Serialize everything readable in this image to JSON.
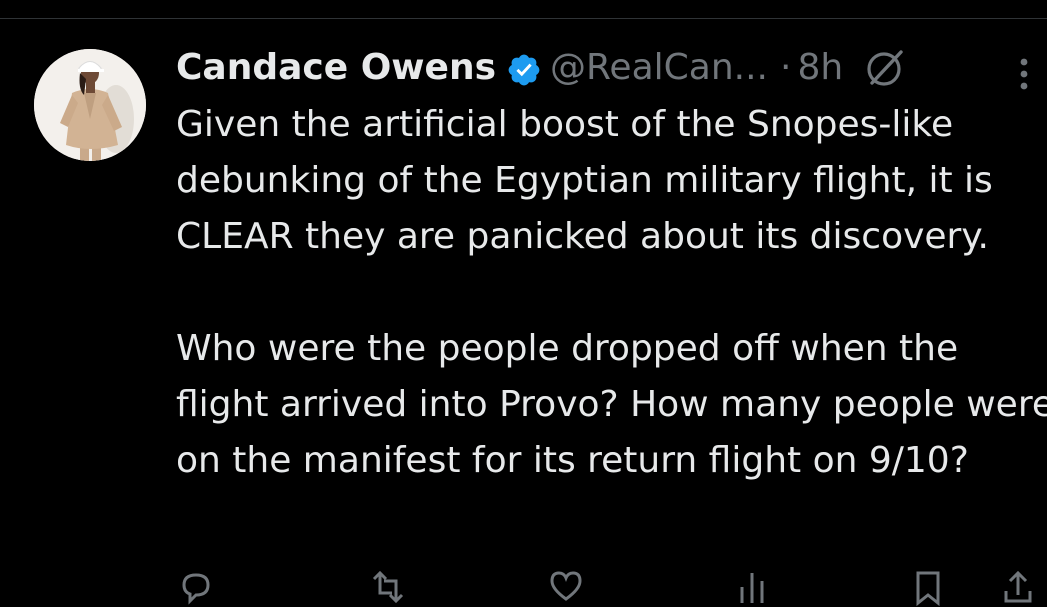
{
  "tweet": {
    "author": {
      "display_name": "Candace Owens",
      "handle": "@RealCan...",
      "verified": true
    },
    "separator": "·",
    "timestamp": "8h",
    "paragraphs": [
      "Given the artificial boost of the Snopes-like debunking of the Egyptian military flight, it is CLEAR they are panicked about its discovery.",
      "Who were the people dropped off when the flight arrived into Provo? How many people were on the manifest for its return flight on 9/10?"
    ],
    "icons": {
      "verified": "verified-badge-icon",
      "grok": "grok-icon",
      "more": "more-options-icon",
      "reply": "reply-icon",
      "repost": "repost-icon",
      "like": "like-icon",
      "views": "views-icon",
      "bookmark": "bookmark-icon",
      "share": "share-icon"
    },
    "colors": {
      "background": "#000000",
      "text": "#e7e9ea",
      "secondary": "#71767b",
      "verified": "#1d9bf0",
      "divider": "#2f3336"
    }
  }
}
